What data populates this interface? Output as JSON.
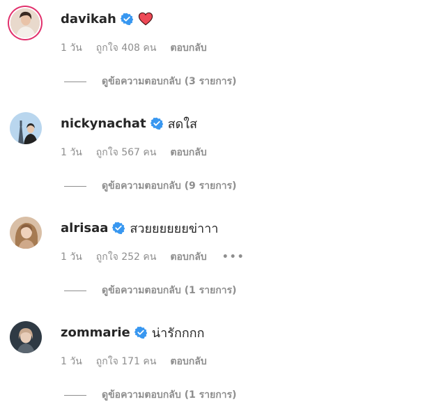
{
  "colors": {
    "verified": "#3897f0",
    "heart": "#ed4956",
    "meta": "#8e8e8e"
  },
  "comments": [
    {
      "username": "davikah",
      "text": "",
      "emoji_icon": "red-heart-icon",
      "time": "1 วัน",
      "likes": "ถูกใจ 408 คน",
      "reply": "ตอบกลับ",
      "view_replies": "ดูข้อความตอบกลับ (3 รายการ)"
    },
    {
      "username": "nickynachat",
      "text": "สดใส",
      "time": "1 วัน",
      "likes": "ถูกใจ 567 คน",
      "reply": "ตอบกลับ",
      "view_replies": "ดูข้อความตอบกลับ (9 รายการ)"
    },
    {
      "username": "alrisaa",
      "text": "สวยยยยยยข่าาา",
      "time": "1 วัน",
      "likes": "ถูกใจ 252 คน",
      "reply": "ตอบกลับ",
      "more": "•••",
      "view_replies": "ดูข้อความตอบกลับ (1 รายการ)"
    },
    {
      "username": "zommarie",
      "text": "น่ารักกกก",
      "time": "1 วัน",
      "likes": "ถูกใจ 171 คน",
      "reply": "ตอบกลับ",
      "view_replies": "ดูข้อความตอบกลับ (1 รายการ)"
    }
  ]
}
